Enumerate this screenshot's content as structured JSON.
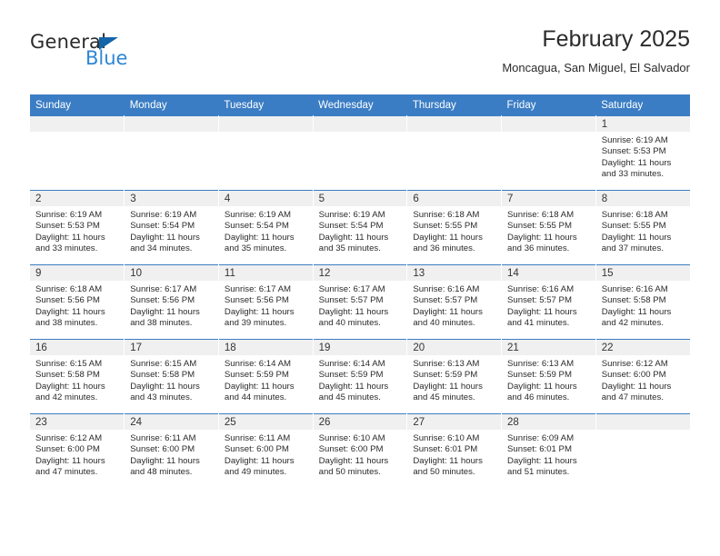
{
  "brand": {
    "name_part1": "General",
    "name_part2": "Blue",
    "triangle_color": "#1464aa",
    "blue_color": "#2f86d6"
  },
  "header": {
    "title": "February 2025",
    "subtitle": "Moncagua, San Miguel, El Salvador"
  },
  "theme": {
    "header_row_bg": "#3b7dc4",
    "daynum_band_bg": "#f0f0f0",
    "grid_line": "#3b7dc4",
    "text": "#2b2b2b"
  },
  "calendar": {
    "weekday_headers": [
      "Sunday",
      "Monday",
      "Tuesday",
      "Wednesday",
      "Thursday",
      "Friday",
      "Saturday"
    ],
    "weeks": [
      [
        {
          "day": "",
          "empty": true
        },
        {
          "day": "",
          "empty": true
        },
        {
          "day": "",
          "empty": true
        },
        {
          "day": "",
          "empty": true
        },
        {
          "day": "",
          "empty": true
        },
        {
          "day": "",
          "empty": true
        },
        {
          "day": "1",
          "sunrise": "Sunrise: 6:19 AM",
          "sunset": "Sunset: 5:53 PM",
          "daylight": "Daylight: 11 hours and 33 minutes."
        }
      ],
      [
        {
          "day": "2",
          "sunrise": "Sunrise: 6:19 AM",
          "sunset": "Sunset: 5:53 PM",
          "daylight": "Daylight: 11 hours and 33 minutes."
        },
        {
          "day": "3",
          "sunrise": "Sunrise: 6:19 AM",
          "sunset": "Sunset: 5:54 PM",
          "daylight": "Daylight: 11 hours and 34 minutes."
        },
        {
          "day": "4",
          "sunrise": "Sunrise: 6:19 AM",
          "sunset": "Sunset: 5:54 PM",
          "daylight": "Daylight: 11 hours and 35 minutes."
        },
        {
          "day": "5",
          "sunrise": "Sunrise: 6:19 AM",
          "sunset": "Sunset: 5:54 PM",
          "daylight": "Daylight: 11 hours and 35 minutes."
        },
        {
          "day": "6",
          "sunrise": "Sunrise: 6:18 AM",
          "sunset": "Sunset: 5:55 PM",
          "daylight": "Daylight: 11 hours and 36 minutes."
        },
        {
          "day": "7",
          "sunrise": "Sunrise: 6:18 AM",
          "sunset": "Sunset: 5:55 PM",
          "daylight": "Daylight: 11 hours and 36 minutes."
        },
        {
          "day": "8",
          "sunrise": "Sunrise: 6:18 AM",
          "sunset": "Sunset: 5:55 PM",
          "daylight": "Daylight: 11 hours and 37 minutes."
        }
      ],
      [
        {
          "day": "9",
          "sunrise": "Sunrise: 6:18 AM",
          "sunset": "Sunset: 5:56 PM",
          "daylight": "Daylight: 11 hours and 38 minutes."
        },
        {
          "day": "10",
          "sunrise": "Sunrise: 6:17 AM",
          "sunset": "Sunset: 5:56 PM",
          "daylight": "Daylight: 11 hours and 38 minutes."
        },
        {
          "day": "11",
          "sunrise": "Sunrise: 6:17 AM",
          "sunset": "Sunset: 5:56 PM",
          "daylight": "Daylight: 11 hours and 39 minutes."
        },
        {
          "day": "12",
          "sunrise": "Sunrise: 6:17 AM",
          "sunset": "Sunset: 5:57 PM",
          "daylight": "Daylight: 11 hours and 40 minutes."
        },
        {
          "day": "13",
          "sunrise": "Sunrise: 6:16 AM",
          "sunset": "Sunset: 5:57 PM",
          "daylight": "Daylight: 11 hours and 40 minutes."
        },
        {
          "day": "14",
          "sunrise": "Sunrise: 6:16 AM",
          "sunset": "Sunset: 5:57 PM",
          "daylight": "Daylight: 11 hours and 41 minutes."
        },
        {
          "day": "15",
          "sunrise": "Sunrise: 6:16 AM",
          "sunset": "Sunset: 5:58 PM",
          "daylight": "Daylight: 11 hours and 42 minutes."
        }
      ],
      [
        {
          "day": "16",
          "sunrise": "Sunrise: 6:15 AM",
          "sunset": "Sunset: 5:58 PM",
          "daylight": "Daylight: 11 hours and 42 minutes."
        },
        {
          "day": "17",
          "sunrise": "Sunrise: 6:15 AM",
          "sunset": "Sunset: 5:58 PM",
          "daylight": "Daylight: 11 hours and 43 minutes."
        },
        {
          "day": "18",
          "sunrise": "Sunrise: 6:14 AM",
          "sunset": "Sunset: 5:59 PM",
          "daylight": "Daylight: 11 hours and 44 minutes."
        },
        {
          "day": "19",
          "sunrise": "Sunrise: 6:14 AM",
          "sunset": "Sunset: 5:59 PM",
          "daylight": "Daylight: 11 hours and 45 minutes."
        },
        {
          "day": "20",
          "sunrise": "Sunrise: 6:13 AM",
          "sunset": "Sunset: 5:59 PM",
          "daylight": "Daylight: 11 hours and 45 minutes."
        },
        {
          "day": "21",
          "sunrise": "Sunrise: 6:13 AM",
          "sunset": "Sunset: 5:59 PM",
          "daylight": "Daylight: 11 hours and 46 minutes."
        },
        {
          "day": "22",
          "sunrise": "Sunrise: 6:12 AM",
          "sunset": "Sunset: 6:00 PM",
          "daylight": "Daylight: 11 hours and 47 minutes."
        }
      ],
      [
        {
          "day": "23",
          "sunrise": "Sunrise: 6:12 AM",
          "sunset": "Sunset: 6:00 PM",
          "daylight": "Daylight: 11 hours and 47 minutes."
        },
        {
          "day": "24",
          "sunrise": "Sunrise: 6:11 AM",
          "sunset": "Sunset: 6:00 PM",
          "daylight": "Daylight: 11 hours and 48 minutes."
        },
        {
          "day": "25",
          "sunrise": "Sunrise: 6:11 AM",
          "sunset": "Sunset: 6:00 PM",
          "daylight": "Daylight: 11 hours and 49 minutes."
        },
        {
          "day": "26",
          "sunrise": "Sunrise: 6:10 AM",
          "sunset": "Sunset: 6:00 PM",
          "daylight": "Daylight: 11 hours and 50 minutes."
        },
        {
          "day": "27",
          "sunrise": "Sunrise: 6:10 AM",
          "sunset": "Sunset: 6:01 PM",
          "daylight": "Daylight: 11 hours and 50 minutes."
        },
        {
          "day": "28",
          "sunrise": "Sunrise: 6:09 AM",
          "sunset": "Sunset: 6:01 PM",
          "daylight": "Daylight: 11 hours and 51 minutes."
        },
        {
          "day": "",
          "empty": true
        }
      ]
    ]
  }
}
